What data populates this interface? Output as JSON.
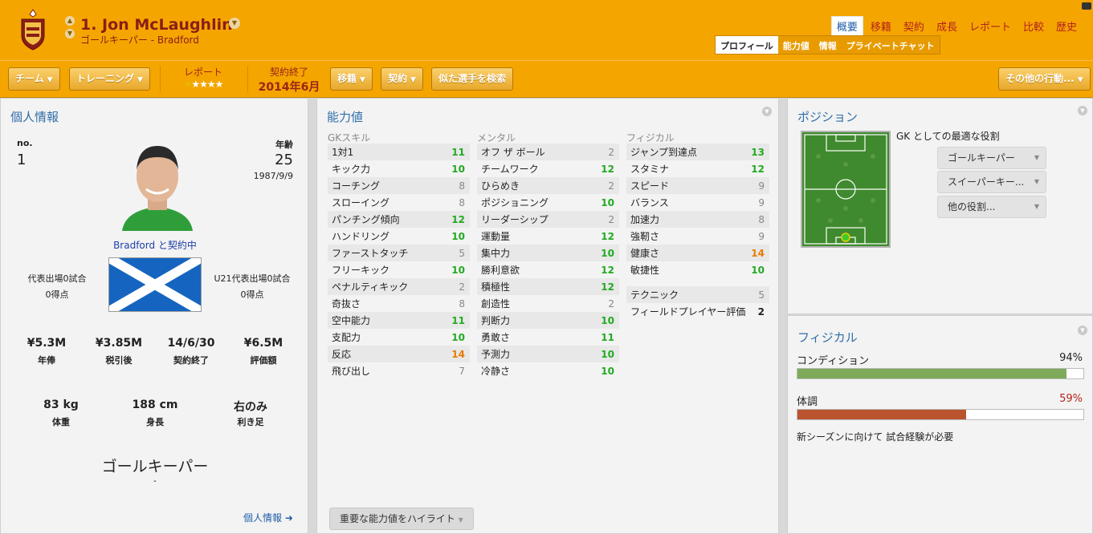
{
  "header": {
    "player_name": "1. Jon McLaughlin",
    "subtitle": "ゴールキーパー - Bradford",
    "tabs": [
      {
        "label": "概要",
        "active": true
      },
      {
        "label": "移籍",
        "active": false
      },
      {
        "label": "契約",
        "active": false
      },
      {
        "label": "成長",
        "active": false
      },
      {
        "label": "レポート",
        "active": false
      },
      {
        "label": "比較",
        "active": false
      },
      {
        "label": "歴史",
        "active": false
      }
    ],
    "subtabs": [
      {
        "label": "プロフィール",
        "active": true
      },
      {
        "label": "能力値",
        "active": false
      },
      {
        "label": "情報",
        "active": false
      },
      {
        "label": "プライベートチャット",
        "active": false
      }
    ]
  },
  "toolbar": {
    "team": "チーム",
    "training": "トレーニング",
    "report_label": "レポート",
    "report_stars": "★★★★★",
    "contract_label": "契約終了",
    "contract_value": "2014年6月",
    "transfer": "移籍",
    "contract_btn": "契約",
    "similar": "似た選手を検索",
    "other": "その他の行動..."
  },
  "personal": {
    "title": "個人情報",
    "no_label": "no.",
    "no_value": "1",
    "age_label": "年齢",
    "age_value": "25",
    "dob": "1987/9/9",
    "club_status": "Bradford と契約中",
    "caps_left": "代表出場0試合",
    "goals_left": "0得点",
    "caps_right": "U21代表出場0試合",
    "goals_right": "0得点",
    "finance": [
      {
        "value": "¥5.3M",
        "label": "年俸"
      },
      {
        "value": "¥3.85M",
        "label": "税引後"
      },
      {
        "value": "14/6/30",
        "label": "契約終了"
      },
      {
        "value": "¥6.5M",
        "label": "評価額"
      }
    ],
    "body": [
      {
        "value": "83 kg",
        "label": "体重"
      },
      {
        "value": "188 cm",
        "label": "身長"
      },
      {
        "value": "右のみ",
        "label": "利き足"
      }
    ],
    "position": "ゴールキーパー",
    "position_sub": "-",
    "more_link": "個人情報 ➜"
  },
  "attributes": {
    "title": "能力値",
    "gk_header": "GKスキル",
    "gk": [
      {
        "name": "1対1",
        "value": "11",
        "tone": "g"
      },
      {
        "name": "キック力",
        "value": "10",
        "tone": "g"
      },
      {
        "name": "コーチング",
        "value": "8",
        "tone": "n"
      },
      {
        "name": "スローイング",
        "value": "8",
        "tone": "n"
      },
      {
        "name": "パンチング傾向",
        "value": "12",
        "tone": "g"
      },
      {
        "name": "ハンドリング",
        "value": "10",
        "tone": "g"
      },
      {
        "name": "ファーストタッチ",
        "value": "5",
        "tone": "n"
      },
      {
        "name": "フリーキック",
        "value": "10",
        "tone": "g"
      },
      {
        "name": "ペナルティキック",
        "value": "2",
        "tone": "n"
      },
      {
        "name": "奇抜さ",
        "value": "8",
        "tone": "n"
      },
      {
        "name": "空中能力",
        "value": "11",
        "tone": "g"
      },
      {
        "name": "支配力",
        "value": "10",
        "tone": "g"
      },
      {
        "name": "反応",
        "value": "14",
        "tone": "o"
      },
      {
        "name": "飛び出し",
        "value": "7",
        "tone": "n"
      }
    ],
    "mental_header": "メンタル",
    "mental": [
      {
        "name": "オフ ザ ボール",
        "value": "2",
        "tone": "n"
      },
      {
        "name": "チームワーク",
        "value": "12",
        "tone": "g"
      },
      {
        "name": "ひらめき",
        "value": "2",
        "tone": "n"
      },
      {
        "name": "ポジショニング",
        "value": "10",
        "tone": "g"
      },
      {
        "name": "リーダーシップ",
        "value": "2",
        "tone": "n"
      },
      {
        "name": "運動量",
        "value": "12",
        "tone": "g"
      },
      {
        "name": "集中力",
        "value": "10",
        "tone": "g"
      },
      {
        "name": "勝利意欲",
        "value": "12",
        "tone": "g"
      },
      {
        "name": "積極性",
        "value": "12",
        "tone": "g"
      },
      {
        "name": "創造性",
        "value": "2",
        "tone": "n"
      },
      {
        "name": "判断力",
        "value": "10",
        "tone": "g"
      },
      {
        "name": "勇敢さ",
        "value": "11",
        "tone": "g"
      },
      {
        "name": "予測力",
        "value": "10",
        "tone": "g"
      },
      {
        "name": "冷静さ",
        "value": "10",
        "tone": "g"
      }
    ],
    "physical_header": "フィジカル",
    "physical": [
      {
        "name": "ジャンプ到達点",
        "value": "13",
        "tone": "g"
      },
      {
        "name": "スタミナ",
        "value": "12",
        "tone": "g"
      },
      {
        "name": "スピード",
        "value": "9",
        "tone": "n"
      },
      {
        "name": "バランス",
        "value": "9",
        "tone": "n"
      },
      {
        "name": "加速力",
        "value": "8",
        "tone": "n"
      },
      {
        "name": "強靭さ",
        "value": "9",
        "tone": "n"
      },
      {
        "name": "健康さ",
        "value": "14",
        "tone": "o"
      },
      {
        "name": "敏捷性",
        "value": "10",
        "tone": "g"
      }
    ],
    "extra": [
      {
        "name": "テクニック",
        "value": "5",
        "tone": "n"
      },
      {
        "name": "フィールドプレイヤー評価",
        "value": "2",
        "tone": "k"
      }
    ],
    "highlight_btn": "重要な能力値をハイライト"
  },
  "position_panel": {
    "title": "ポジション",
    "best_role": "GK としての最適な役割",
    "roles": [
      "ゴールキーパー",
      "スイーパーキー...",
      "他の役割..."
    ]
  },
  "physical_panel": {
    "title": "フィジカル",
    "condition_label": "コンディション",
    "condition_value": "94%",
    "condition_fraction": 0.94,
    "condition_color": "#7eaa5a",
    "fitness_label": "体調",
    "fitness_value": "59%",
    "fitness_fraction": 0.59,
    "fitness_color": "#b9542f",
    "note": "新シーズンに向けて 試合経験が必要"
  },
  "colors": {
    "header_bg": "#f5a500",
    "name_color": "#8b1d16",
    "title_blue": "#2f6ea8",
    "good": "#22aa22",
    "key": "#e87a00"
  }
}
